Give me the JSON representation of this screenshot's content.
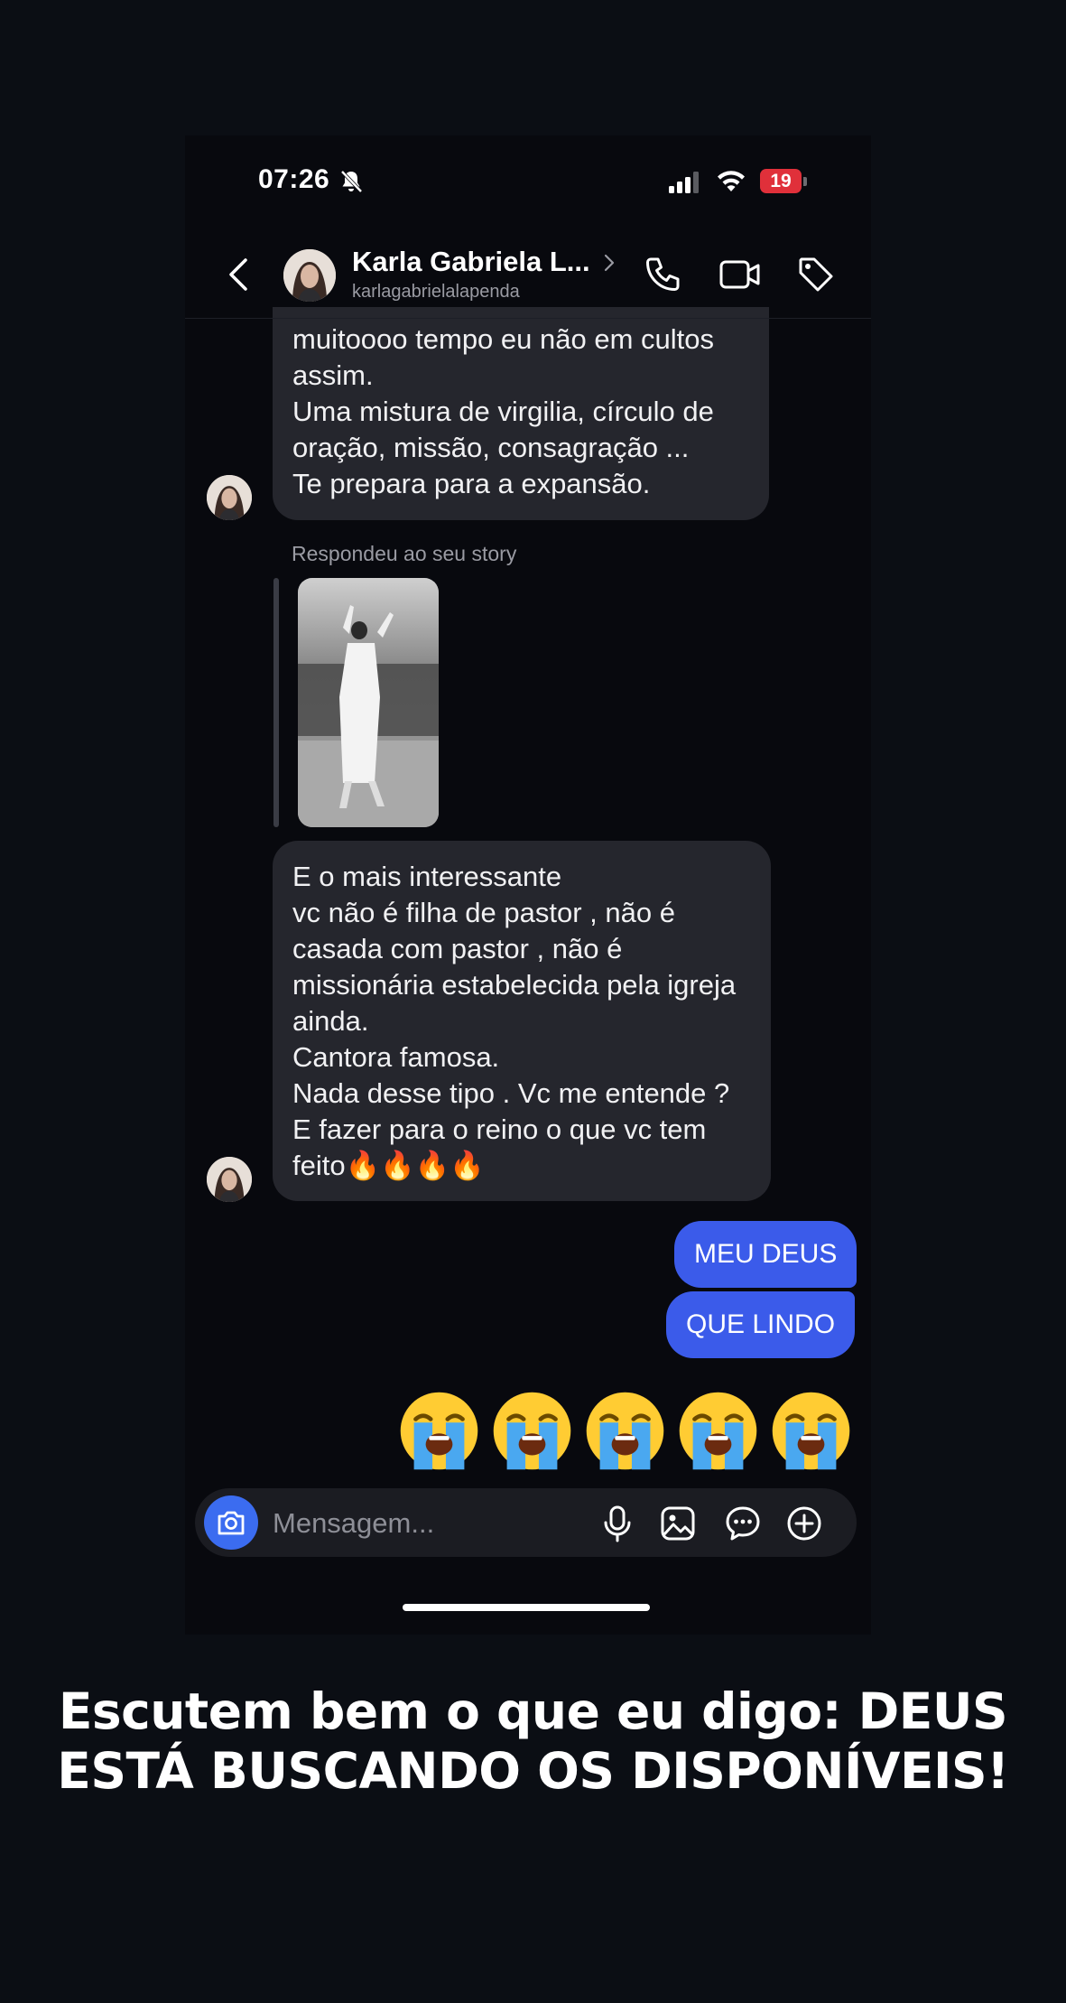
{
  "status_bar": {
    "time": "07:26",
    "battery_level": "19",
    "icons": [
      "bell-muted-icon",
      "cellular-signal-icon",
      "wifi-icon",
      "battery-icon"
    ]
  },
  "header": {
    "contact_name": "Karla Gabriela L...",
    "contact_username": "karlagabrielalapenda",
    "icons": [
      "chevron-left-icon",
      "chevron-right-icon",
      "phone-icon",
      "video-camera-icon",
      "tag-icon"
    ]
  },
  "messages": {
    "incoming_1": {
      "lines": [
        "muitoooo tempo eu não em cultos",
        "assim.",
        "Uma mistura de virgilia, círculo de",
        "oração, missão, consagração ...",
        "Te prepara para a expansão."
      ]
    },
    "story_reply_label": "Respondeu ao seu story",
    "incoming_2": {
      "lines": [
        "E o mais interessante",
        "vc não é filha de pastor , não é",
        "casada com pastor , não é",
        "missionária estabelecida pela igreja",
        "ainda.",
        "Cantora famosa.",
        "Nada desse tipo . Vc me entende ?",
        "E fazer para o reino o que vc tem",
        "feito🔥🔥🔥🔥"
      ]
    },
    "outgoing": [
      "MEU DEUS",
      "QUE LINDO"
    ],
    "emoji_count": 5,
    "emoji_icon": "loudly-crying-face-icon"
  },
  "composer": {
    "placeholder": "Mensagem...",
    "icons": [
      "camera-icon",
      "microphone-icon",
      "gallery-icon",
      "sticker-icon",
      "plus-icon"
    ]
  },
  "caption": {
    "lines": [
      "Escutem bem o que eu digo: DEUS",
      "ESTÁ BUSCANDO OS DISPONÍVEIS!"
    ]
  },
  "colors": {
    "background": "#0b0e14",
    "incoming_bubble": "#25262d",
    "outgoing_bubble": "#3b5bea",
    "camera_button": "#3b6cf0",
    "battery_low": "#e0303a"
  }
}
